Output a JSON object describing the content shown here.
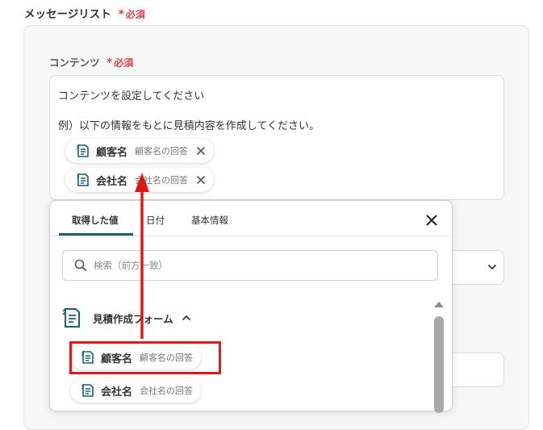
{
  "section": {
    "title": "メッセージリスト",
    "required": "必須"
  },
  "content": {
    "label": "コンテンツ",
    "required": "必須",
    "line1": "コンテンツを設定してください",
    "line2": "例）以下の情報をもとに見積内容を作成してください。",
    "chips": [
      {
        "name": "顧客名",
        "sub": "顧客名の回答"
      },
      {
        "name": "会社名",
        "sub": "会社名の回答"
      }
    ]
  },
  "popup": {
    "tabs": [
      "取得した値",
      "日付",
      "基本情報"
    ],
    "active_tab": 0,
    "search_placeholder": "検索（前方一致）",
    "group": {
      "label": "見積作成フォーム"
    },
    "items": [
      {
        "name": "顧客名",
        "sub": "顧客名の回答"
      },
      {
        "name": "会社名",
        "sub": "会社名の回答"
      }
    ]
  },
  "annotation": {
    "color": "#e01818",
    "highlighted_item": "顧客名"
  },
  "colors": {
    "accent": "#1b5f7a",
    "required": "#e0434b",
    "icon": "#1b5f7a"
  }
}
